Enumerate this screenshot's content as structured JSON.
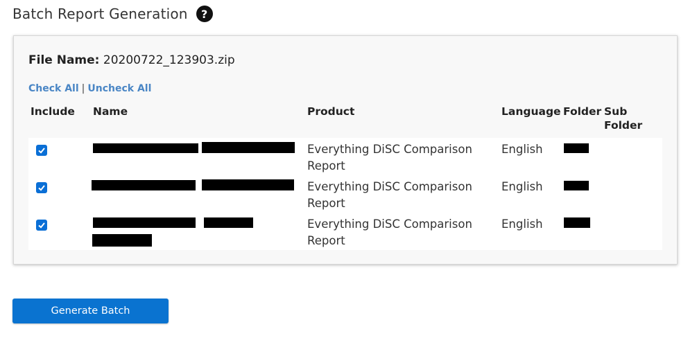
{
  "page": {
    "title": "Batch Report Generation",
    "help_glyph": "?"
  },
  "file": {
    "label": "File Name:",
    "value": "20200722_123903.zip"
  },
  "links": {
    "check_all": "Check All",
    "separator": "|",
    "uncheck_all": "Uncheck All"
  },
  "table": {
    "headers": {
      "include": "Include",
      "name": "Name",
      "product": "Product",
      "language": "Language",
      "folder": "Folder",
      "sub_folder_1": "Sub",
      "sub_folder_2": "Folder"
    },
    "rows": [
      {
        "checked": true,
        "product_1": "Everything DiSC Comparison",
        "product_2": "Report",
        "language": "English"
      },
      {
        "checked": true,
        "product_1": "Everything DiSC Comparison",
        "product_2": "Report",
        "language": "English"
      },
      {
        "checked": true,
        "product_1": "Everything DiSC Comparison",
        "product_2": "Report",
        "language": "English"
      }
    ]
  },
  "actions": {
    "generate_label": "Generate Batch"
  },
  "colors": {
    "accent": "#0a73d0",
    "link": "#4a86c5",
    "panel_bg": "#f8f8f8"
  }
}
